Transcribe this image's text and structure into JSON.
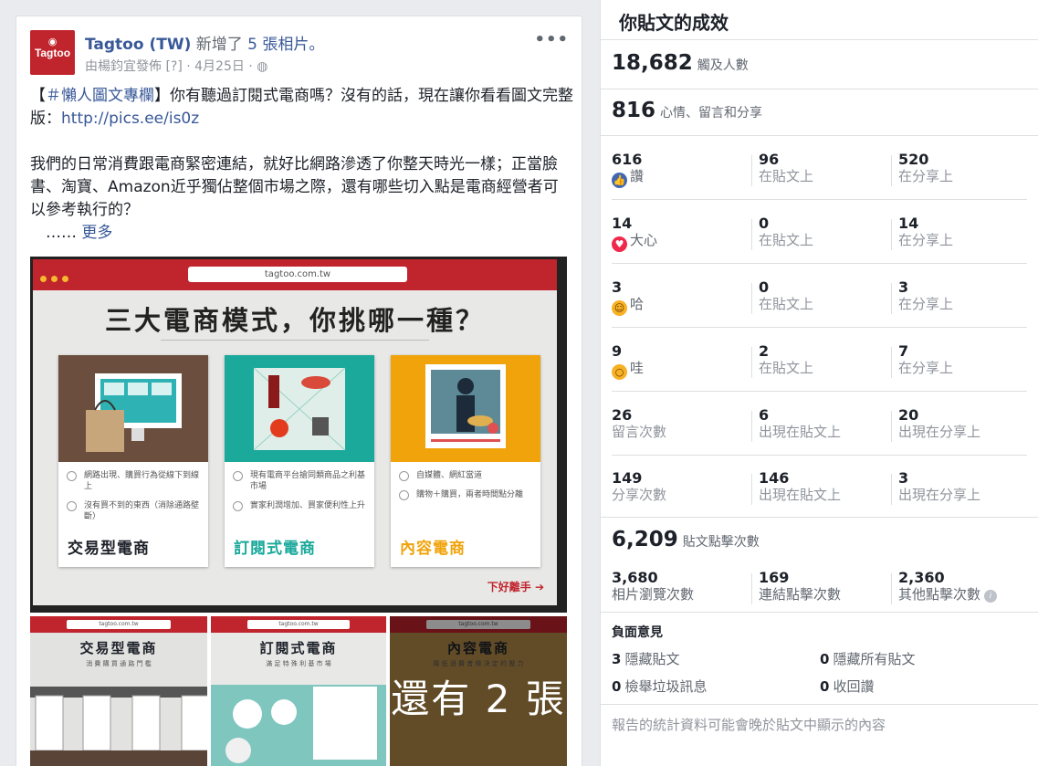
{
  "post": {
    "page_name": "Tagtoo (TW)",
    "added_text": "新增了",
    "added_link": "5 張相片。",
    "avatar_text": "Tagtoo",
    "meta_text": "由楊鈞宜發佈 [?] · 4月25日 ·",
    "menu": "•••",
    "para1_prefix": "【",
    "hashtag": "＃懶人圖文專欄",
    "para1_rest": "】你有聽過訂閱式電商嗎？沒有的話，現在讓你看看圖文完整版：",
    "para1_link": "http://pics.ee/is0z",
    "para2": "我們的日常消費跟電商緊密連結，就好比網路滲透了你整天時光一樣；正當臉書、淘寶、Amazon近乎獨佔整個市場之際，還有哪些切入點是電商經營者可以參考執行的？",
    "ellipsis": "　……",
    "see_more": "更多",
    "image": {
      "url": "tagtoo.com.tw",
      "headline": "三大電商模式，你挑哪一種？",
      "cards": [
        {
          "p1": "網路出現、購買行為從線下到線上",
          "p2": "沒有買不到的東西（消除通路壁斷）",
          "title": "交易型電商",
          "color": "#1d2129"
        },
        {
          "p1": "現有電商平台搶同類商品之利基市場",
          "p2": "實家利潤增加、買家便利性上升",
          "title": "訂閱式電商",
          "color": "#1aa99b"
        },
        {
          "p1": "自媒體、網紅當道",
          "p2": "購物＋購買，兩者時間點分離",
          "title": "內容電商",
          "color": "#f0a30a"
        }
      ],
      "next": "下好離手 ➔"
    },
    "thumbs": [
      {
        "title": "交易型電商",
        "sub": "消 費 購 買 通 路 門 檻"
      },
      {
        "title": "訂閱式電商",
        "sub": "滿 足 特 殊 利 基 市 場"
      },
      {
        "title": "內容電商",
        "sub": "降 低 消 費 者 做 決 定 的 壓 力"
      }
    ],
    "more_photos": "還有 2 張"
  },
  "insights": {
    "title": "你貼文的成效",
    "reach": {
      "value": "18,682",
      "label": "觸及人數"
    },
    "engagement": {
      "value": "816",
      "label": "心情、留言和分享"
    },
    "rows": [
      {
        "total": "616",
        "label": "讚",
        "icon": "like-icon",
        "on_post": "96",
        "on_shares": "520",
        "post_label": "在貼文上",
        "share_label": "在分享上"
      },
      {
        "total": "14",
        "label": "大心",
        "icon": "love-icon",
        "on_post": "0",
        "on_shares": "14",
        "post_label": "在貼文上",
        "share_label": "在分享上"
      },
      {
        "total": "3",
        "label": "哈",
        "icon": "haha-icon",
        "on_post": "0",
        "on_shares": "3",
        "post_label": "在貼文上",
        "share_label": "在分享上"
      },
      {
        "total": "9",
        "label": "哇",
        "icon": "wow-icon",
        "on_post": "2",
        "on_shares": "7",
        "post_label": "在貼文上",
        "share_label": "在分享上"
      },
      {
        "total": "26",
        "label": "留言次數",
        "on_post": "6",
        "on_shares": "20",
        "post_label": "出現在貼文上",
        "share_label": "出現在分享上"
      },
      {
        "total": "149",
        "label": "分享次數",
        "on_post": "146",
        "on_shares": "3",
        "post_label": "出現在貼文上",
        "share_label": "出現在分享上"
      }
    ],
    "clicks": {
      "value": "6,209",
      "label": "貼文點擊次數"
    },
    "click_rows": [
      {
        "value": "3,680",
        "label": "相片瀏覽次數"
      },
      {
        "value": "169",
        "label": "連結點擊次數"
      },
      {
        "value": "2,360",
        "label": "其他點擊次數"
      }
    ],
    "negative": {
      "title": "負面意見",
      "items": [
        {
          "value": "3",
          "label": "隱藏貼文"
        },
        {
          "value": "0",
          "label": "隱藏所有貼文"
        },
        {
          "value": "0",
          "label": "檢舉垃圾訊息"
        },
        {
          "value": "0",
          "label": "收回讚"
        }
      ]
    },
    "footnote": "報告的統計資料可能會晚於貼文中顯示的內容"
  }
}
